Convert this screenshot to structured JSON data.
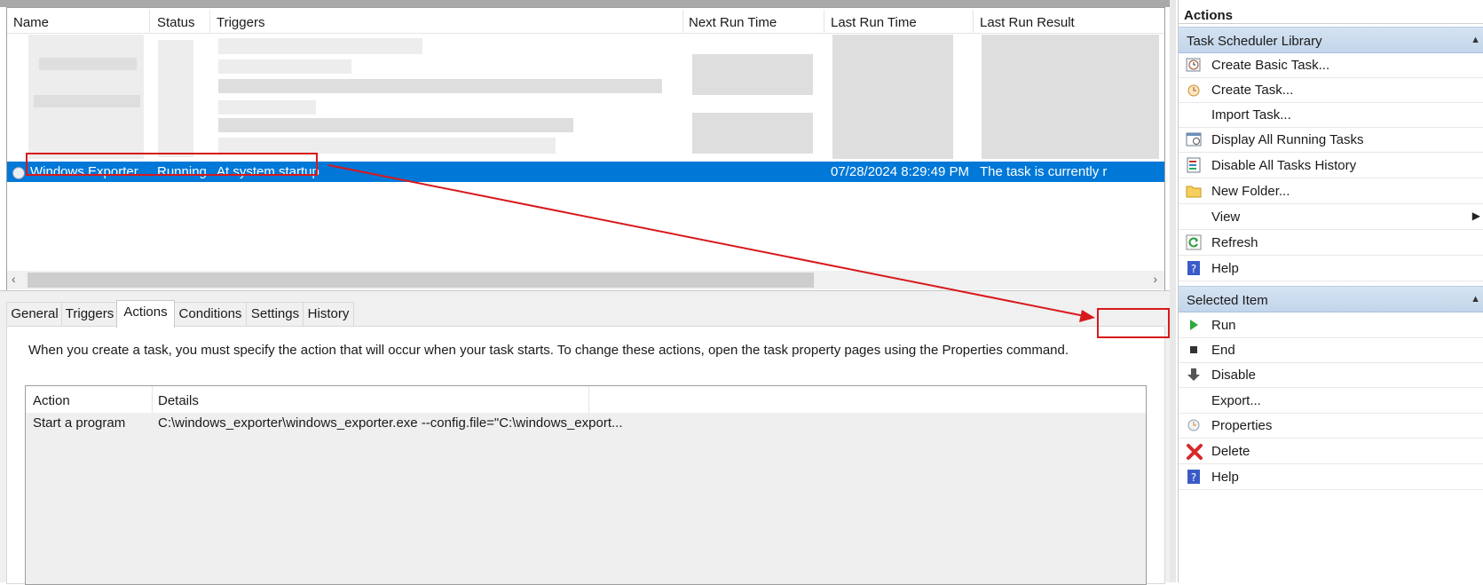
{
  "task_list": {
    "columns": [
      "Name",
      "Status",
      "Triggers",
      "Next Run Time",
      "Last Run Time",
      "Last Run Result"
    ],
    "selected_row": {
      "name": "Windows Exporter",
      "status": "Running",
      "triggers": "At system startup",
      "next_run_time": "",
      "last_run_time": "07/28/2024 8:29:49 PM",
      "last_run_result": "The task is currently r"
    }
  },
  "tabs": [
    "General",
    "Triggers",
    "Actions",
    "Conditions",
    "Settings",
    "History"
  ],
  "active_tab": "Actions",
  "actions_tab": {
    "description": "When you create a task, you must specify the action that will occur when your task starts.  To change these actions, open the task property pages using the Properties command.",
    "columns": [
      "Action",
      "Details"
    ],
    "rows": [
      {
        "action": "Start a program",
        "details": "C:\\windows_exporter\\windows_exporter.exe --config.file=\"C:\\windows_export..."
      }
    ]
  },
  "actions_pane": {
    "title": "Actions",
    "library_section": "Task Scheduler Library",
    "library_items": [
      {
        "label": "Create Basic Task...",
        "icon": "create-basic-task-icon"
      },
      {
        "label": "Create Task...",
        "icon": "create-task-icon"
      },
      {
        "label": "Import Task...",
        "icon": ""
      },
      {
        "label": "Display All Running Tasks",
        "icon": "running-tasks-icon"
      },
      {
        "label": "Disable All Tasks History",
        "icon": "disable-history-icon"
      },
      {
        "label": "New Folder...",
        "icon": "folder-icon"
      },
      {
        "label": "View",
        "icon": "",
        "submenu": true
      },
      {
        "label": "Refresh",
        "icon": "refresh-icon"
      },
      {
        "label": "Help",
        "icon": "help-icon"
      }
    ],
    "selected_section": "Selected Item",
    "selected_items": [
      {
        "label": "Run",
        "icon": "run-icon"
      },
      {
        "label": "End",
        "icon": "stop-icon"
      },
      {
        "label": "Disable",
        "icon": "disable-arrow-icon"
      },
      {
        "label": "Export...",
        "icon": ""
      },
      {
        "label": "Properties",
        "icon": "properties-icon"
      },
      {
        "label": "Delete",
        "icon": "delete-icon"
      },
      {
        "label": "Help",
        "icon": "help-icon"
      }
    ]
  },
  "colors": {
    "selection": "#0078d7",
    "annotation": "#d8191c",
    "section_header": "#c2d5ea"
  }
}
